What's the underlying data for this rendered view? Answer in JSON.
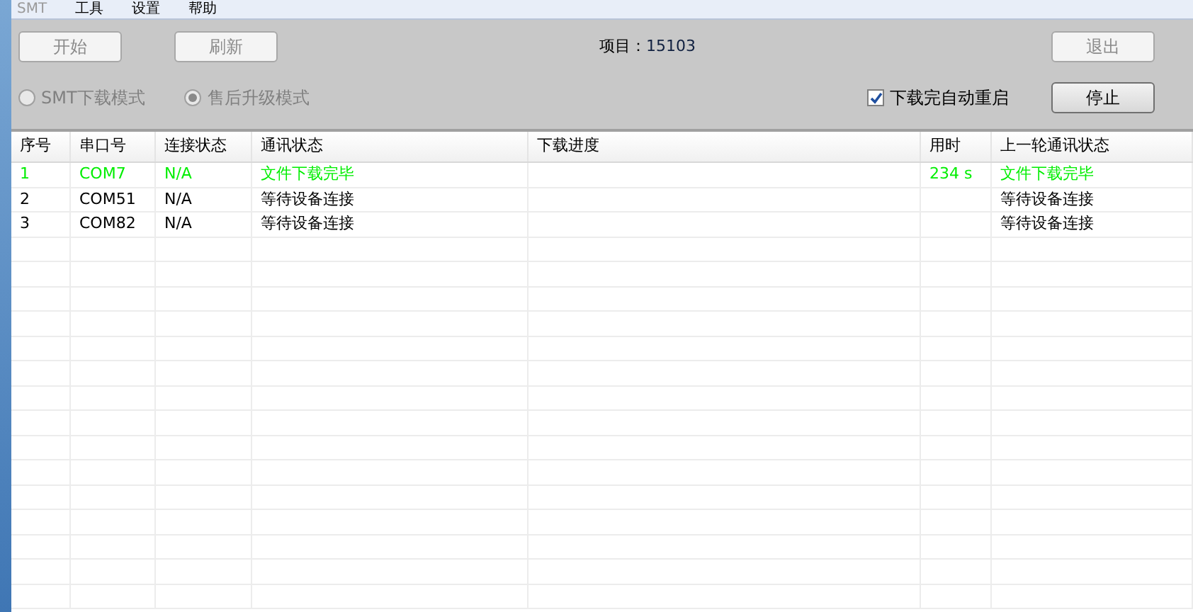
{
  "menu": [
    {
      "label": "SMT",
      "disabled": true
    },
    {
      "label": "工具",
      "disabled": false
    },
    {
      "label": "设置",
      "disabled": false
    },
    {
      "label": "帮助",
      "disabled": false
    }
  ],
  "toolbar": {
    "start_button": {
      "label": "开始",
      "disabled": true
    },
    "refresh_button": {
      "label": "刷新",
      "disabled": true
    },
    "project_label": "项目：",
    "project_value": "15103",
    "exit_button": {
      "label": "退出",
      "disabled": true
    },
    "stop_button": {
      "label": "停止",
      "disabled": false
    },
    "modes": [
      {
        "label": "SMT下载模式",
        "selected": false,
        "disabled": true
      },
      {
        "label": "售后升级模式",
        "selected": true,
        "disabled": true
      }
    ],
    "auto_restart": {
      "label": "下载完自动重启",
      "checked": true
    }
  },
  "table": {
    "columns": [
      "序号",
      "串口号",
      "连接状态",
      "通讯状态",
      "下载进度",
      "用时",
      "上一轮通讯状态"
    ],
    "rows": [
      {
        "color": "#00ee00",
        "cells": [
          "1",
          "COM7",
          "N/A",
          "文件下载完毕",
          "",
          "234 s",
          "文件下载完毕"
        ]
      },
      {
        "color": "#000000",
        "cells": [
          "2",
          "COM51",
          "N/A",
          "等待设备连接",
          "",
          "",
          "等待设备连接"
        ]
      },
      {
        "color": "#000000",
        "cells": [
          "3",
          "COM82",
          "N/A",
          "等待设备连接",
          "",
          "",
          "等待设备连接"
        ]
      }
    ]
  }
}
